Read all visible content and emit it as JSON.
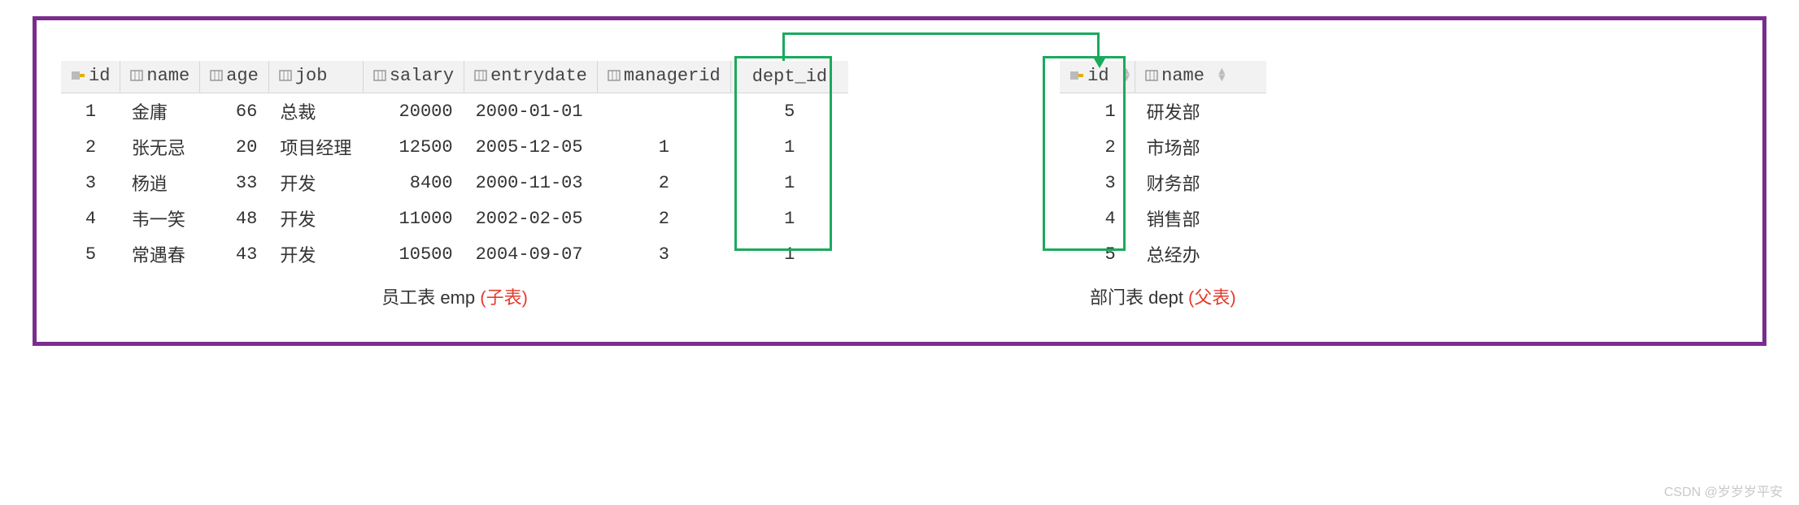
{
  "emp_table": {
    "headers": {
      "id": "id",
      "name": "name",
      "age": "age",
      "job": "job",
      "salary": "salary",
      "entrydate": "entrydate",
      "managerid": "managerid",
      "dept_id": "dept_id"
    },
    "rows": [
      {
        "id": "1",
        "name": "金庸",
        "age": "66",
        "job": "总裁",
        "salary": "20000",
        "entrydate": "2000-01-01",
        "managerid": "<null>",
        "dept_id": "5"
      },
      {
        "id": "2",
        "name": "张无忌",
        "age": "20",
        "job": "项目经理",
        "salary": "12500",
        "entrydate": "2005-12-05",
        "managerid": "1",
        "dept_id": "1"
      },
      {
        "id": "3",
        "name": "杨逍",
        "age": "33",
        "job": "开发",
        "salary": "8400",
        "entrydate": "2000-11-03",
        "managerid": "2",
        "dept_id": "1"
      },
      {
        "id": "4",
        "name": "韦一笑",
        "age": "48",
        "job": "开发",
        "salary": "11000",
        "entrydate": "2002-02-05",
        "managerid": "2",
        "dept_id": "1"
      },
      {
        "id": "5",
        "name": "常遇春",
        "age": "43",
        "job": "开发",
        "salary": "10500",
        "entrydate": "2004-09-07",
        "managerid": "3",
        "dept_id": "1"
      }
    ],
    "caption_main": "员工表 emp ",
    "caption_red": "(子表)"
  },
  "dept_table": {
    "headers": {
      "id": "id",
      "name": "name"
    },
    "rows": [
      {
        "id": "1",
        "name": "研发部"
      },
      {
        "id": "2",
        "name": "市场部"
      },
      {
        "id": "3",
        "name": "财务部"
      },
      {
        "id": "4",
        "name": "销售部"
      },
      {
        "id": "5",
        "name": "总经办"
      }
    ],
    "caption_main": "部门表 dept ",
    "caption_red": "(父表)"
  },
  "watermark": "CSDN @岁岁岁平安",
  "chart_data": {
    "type": "table",
    "tables": [
      {
        "name": "emp",
        "columns": [
          "id",
          "name",
          "age",
          "job",
          "salary",
          "entrydate",
          "managerid",
          "dept_id"
        ],
        "rows": [
          [
            1,
            "金庸",
            66,
            "总裁",
            20000,
            "2000-01-01",
            null,
            5
          ],
          [
            2,
            "张无忌",
            20,
            "项目经理",
            12500,
            "2005-12-05",
            1,
            1
          ],
          [
            3,
            "杨逍",
            33,
            "开发",
            8400,
            "2000-11-03",
            2,
            1
          ],
          [
            4,
            "韦一笑",
            48,
            "开发",
            11000,
            "2002-02-05",
            2,
            1
          ],
          [
            5,
            "常遇春",
            43,
            "开发",
            10500,
            "2004-09-07",
            3,
            1
          ]
        ]
      },
      {
        "name": "dept",
        "columns": [
          "id",
          "name"
        ],
        "rows": [
          [
            1,
            "研发部"
          ],
          [
            2,
            "市场部"
          ],
          [
            3,
            "财务部"
          ],
          [
            4,
            "销售部"
          ],
          [
            5,
            "总经办"
          ]
        ]
      }
    ],
    "relation": {
      "from": "emp.dept_id",
      "to": "dept.id"
    }
  }
}
